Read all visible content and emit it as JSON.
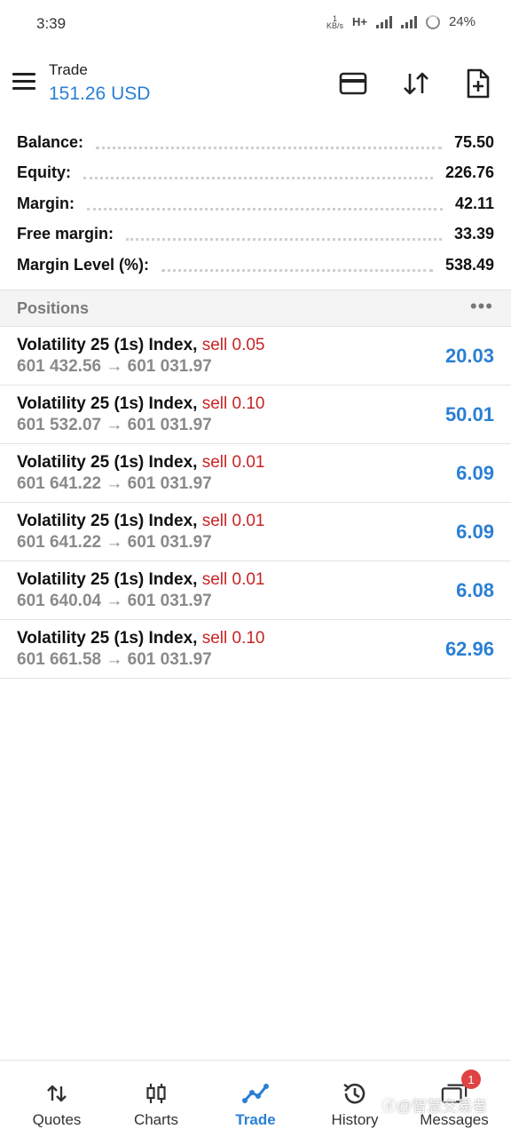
{
  "status_bar": {
    "time": "3:39",
    "net_speed_top": "1",
    "net_speed_bottom": "KB/s",
    "network_type": "H+",
    "battery": "24%"
  },
  "header": {
    "title": "Trade",
    "subtitle": "151.26 USD",
    "icons": [
      "menu-icon",
      "credit-card-icon",
      "sort-arrows-icon",
      "new-order-icon"
    ]
  },
  "summary": [
    {
      "label": "Balance:",
      "value": "75.50"
    },
    {
      "label": "Equity:",
      "value": "226.76"
    },
    {
      "label": "Margin:",
      "value": "42.11"
    },
    {
      "label": "Free margin:",
      "value": "33.39"
    },
    {
      "label": "Margin Level (%):",
      "value": "538.49"
    }
  ],
  "positions": {
    "title": "Positions",
    "more": "•••",
    "items": [
      {
        "symbol": "Volatility 25 (1s) Index,",
        "side": "sell 0.05",
        "prices": "601 432.56 → 601 031.97",
        "profit": "20.03"
      },
      {
        "symbol": "Volatility 25 (1s) Index,",
        "side": "sell 0.10",
        "prices": "601 532.07 → 601 031.97",
        "profit": "50.01"
      },
      {
        "symbol": "Volatility 25 (1s) Index,",
        "side": "sell 0.01",
        "prices": "601 641.22 → 601 031.97",
        "profit": "6.09"
      },
      {
        "symbol": "Volatility 25 (1s) Index,",
        "side": "sell 0.01",
        "prices": "601 641.22 → 601 031.97",
        "profit": "6.09"
      },
      {
        "symbol": "Volatility 25 (1s) Index,",
        "side": "sell 0.01",
        "prices": "601 640.04 → 601 031.97",
        "profit": "6.08"
      },
      {
        "symbol": "Volatility 25 (1s) Index,",
        "side": "sell 0.10",
        "prices": "601 661.58 → 601 031.97",
        "profit": "62.96"
      }
    ]
  },
  "bottom_nav": {
    "items": [
      {
        "label": "Quotes",
        "icon": "quotes-icon"
      },
      {
        "label": "Charts",
        "icon": "candlestick-icon"
      },
      {
        "label": "Trade",
        "icon": "trade-line-icon"
      },
      {
        "label": "History",
        "icon": "history-icon"
      },
      {
        "label": "Messages",
        "icon": "messages-icon"
      }
    ],
    "active": "Trade",
    "messages_badge": "1"
  },
  "watermark": "ⓓ@智慧交易者",
  "colors": {
    "accent": "#2a7fd4",
    "sell": "#c82424",
    "badge": "#e04343"
  }
}
